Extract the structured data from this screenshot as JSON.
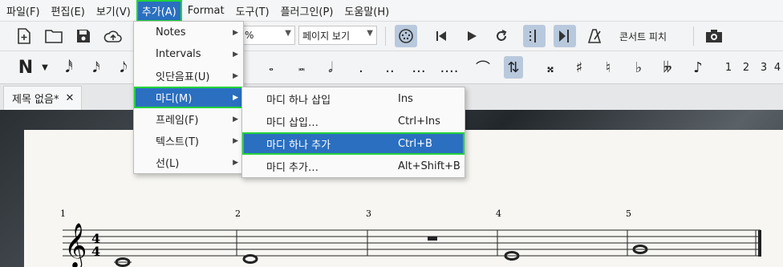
{
  "menubar": {
    "items": [
      "파일(F)",
      "편집(E)",
      "보기(V)",
      "추가(A)",
      "Format",
      "도구(T)",
      "플러그인(P)",
      "도움말(H)"
    ]
  },
  "toolbar": {
    "zoom_value": "%",
    "view_mode": "페이지 보기",
    "concert_pitch": "콘서트 피치"
  },
  "note_input": {
    "numbers": [
      "1",
      "2",
      "3",
      "4"
    ]
  },
  "tab": {
    "title": "제목 없음*"
  },
  "add_menu": {
    "items": [
      "Notes",
      "Intervals",
      "잇단음표(U)",
      "마디(M)",
      "프레임(F)",
      "텍스트(T)",
      "선(L)"
    ]
  },
  "measures_menu": {
    "items": [
      {
        "label": "마디 하나 삽입",
        "shortcut": "Ins"
      },
      {
        "label": "마디 삽입…",
        "shortcut": "Ctrl+Ins"
      },
      {
        "label": "마디 하나 추가",
        "shortcut": "Ctrl+B"
      },
      {
        "label": "마디 추가…",
        "shortcut": "Alt+Shift+B"
      }
    ]
  },
  "score": {
    "measure_numbers": [
      "1",
      "2",
      "3",
      "4",
      "5"
    ],
    "time_signature": {
      "top": "4",
      "bottom": "4"
    }
  },
  "colors": {
    "highlight": "#2a6fc0",
    "focus_outline": "#22d33a"
  }
}
